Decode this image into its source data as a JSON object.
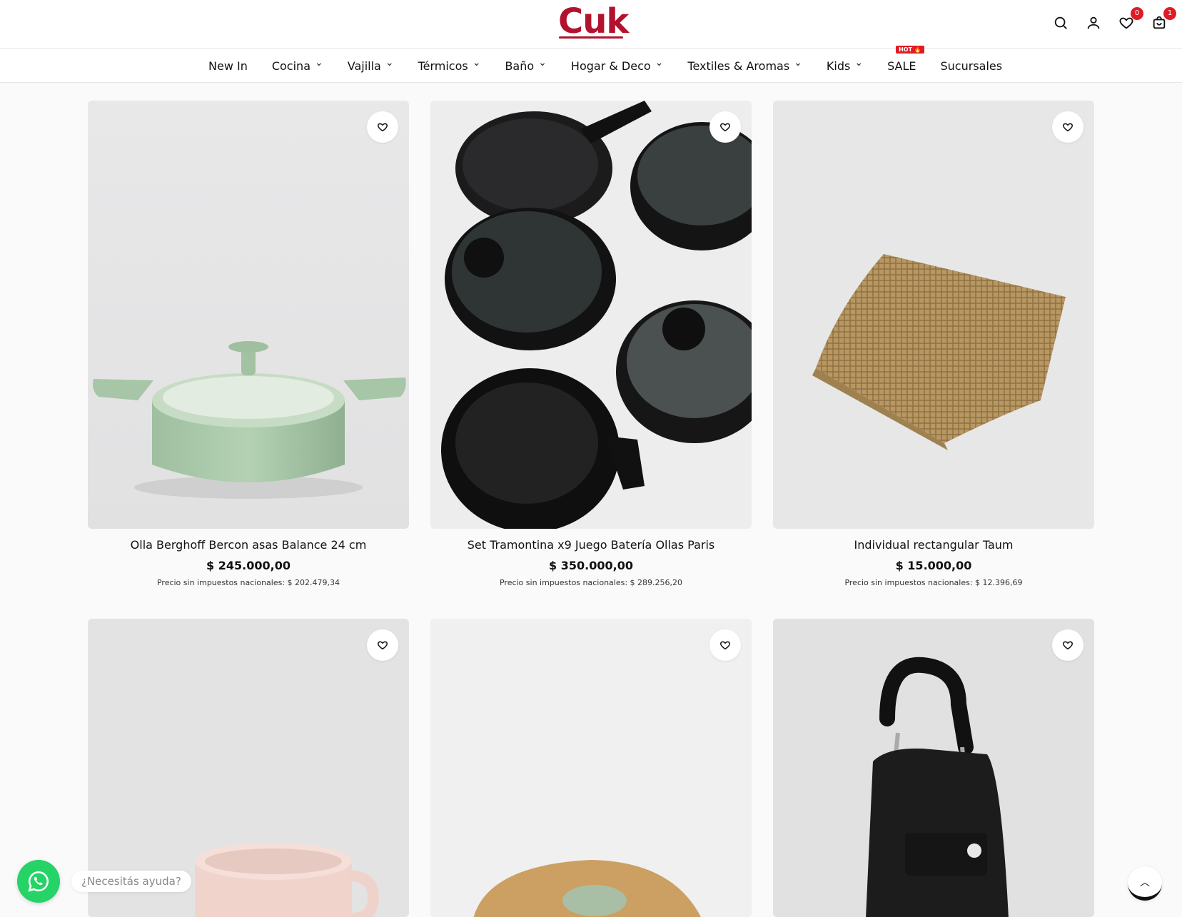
{
  "header": {
    "logo": "Cuk",
    "wishlist_count": "0",
    "cart_count": "1",
    "icons": [
      "search-icon",
      "account-icon",
      "heart-icon",
      "cart-icon"
    ]
  },
  "nav": {
    "items": [
      {
        "label": "New In",
        "dropdown": false
      },
      {
        "label": "Cocina",
        "dropdown": true
      },
      {
        "label": "Vajilla",
        "dropdown": true
      },
      {
        "label": "Térmicos",
        "dropdown": true
      },
      {
        "label": "Baño",
        "dropdown": true
      },
      {
        "label": "Hogar & Deco",
        "dropdown": true
      },
      {
        "label": "Textiles & Aromas",
        "dropdown": true
      },
      {
        "label": "Kids",
        "dropdown": true
      },
      {
        "label": "SALE",
        "dropdown": false
      },
      {
        "label": "Sucursales",
        "dropdown": false
      }
    ],
    "hot_badge": "HOT 🔥"
  },
  "products": [
    {
      "title": "Olla Berghoff Bercon asas Balance 24 cm",
      "price": "$ 245.000,00",
      "tax_note": "Precio sin impuestos nacionales: $ 202.479,34"
    },
    {
      "title": "Set Tramontina x9 Juego Batería Ollas Paris",
      "price": "$ 350.000,00",
      "tax_note": "Precio sin impuestos nacionales: $ 289.256,20"
    },
    {
      "title": "Individual rectangular Taum",
      "price": "$ 15.000,00",
      "tax_note": "Precio sin impuestos nacionales: $ 12.396,69"
    },
    {
      "title": "",
      "price": "",
      "tax_note": ""
    },
    {
      "title": "",
      "price": "",
      "tax_note": ""
    },
    {
      "title": "",
      "price": "",
      "tax_note": ""
    }
  ],
  "whatsapp": {
    "tooltip": "¿Necesitás ayuda?"
  },
  "colors": {
    "brand": "#b3122f",
    "badge": "#e01b24",
    "whatsapp": "#25d366"
  }
}
